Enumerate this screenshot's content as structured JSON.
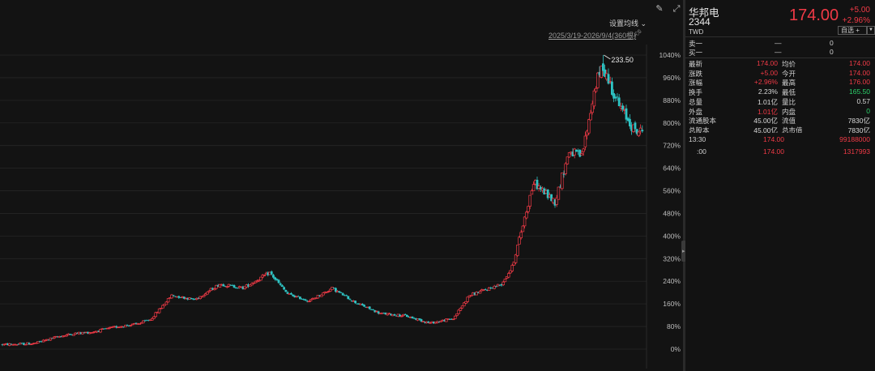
{
  "toolbar": {
    "draw_icon": "pencil-icon",
    "expand_icon": "expand-icon",
    "ma_setting_label": "设置均线",
    "date_range": "2025/3/19-2026/9/4(360根)"
  },
  "colors": {
    "up": "#f03a46",
    "down": "#2ec4c4",
    "green": "#2bd26b",
    "grid": "#262626",
    "background": "#131313"
  },
  "chart_data": {
    "type": "candlestick",
    "title": "",
    "xlabel": "",
    "ylabel": "",
    "y_axis_unit": "%",
    "ylim": [
      -8,
      1060
    ],
    "y_ticks": [
      "1040%",
      "960%",
      "880%",
      "800%",
      "720%",
      "640%",
      "560%",
      "480%",
      "400%",
      "320%",
      "240%",
      "160%",
      "80%",
      "0%"
    ],
    "y_tick_values": [
      1040,
      960,
      880,
      800,
      720,
      640,
      560,
      480,
      400,
      320,
      240,
      160,
      80,
      0
    ],
    "candle_count": 360,
    "start_date": "2025/3/19",
    "end_date": "2026/9/4",
    "peak_label": "233.50",
    "peak_value_pct": 1040,
    "generator_anchors_pct": [
      [
        0,
        16
      ],
      [
        10,
        18
      ],
      [
        18,
        20
      ],
      [
        30,
        42
      ],
      [
        40,
        55
      ],
      [
        50,
        60
      ],
      [
        65,
        80
      ],
      [
        75,
        88
      ],
      [
        83,
        104
      ],
      [
        95,
        190
      ],
      [
        108,
        175
      ],
      [
        122,
        230
      ],
      [
        135,
        216
      ],
      [
        150,
        270
      ],
      [
        160,
        195
      ],
      [
        172,
        170
      ],
      [
        185,
        215
      ],
      [
        198,
        165
      ],
      [
        212,
        126
      ],
      [
        226,
        118
      ],
      [
        240,
        92
      ],
      [
        253,
        108
      ],
      [
        262,
        190
      ],
      [
        280,
        230
      ],
      [
        286,
        290
      ],
      [
        298,
        590
      ],
      [
        310,
        520
      ],
      [
        318,
        700
      ],
      [
        325,
        680
      ],
      [
        333,
        940
      ],
      [
        337,
        1000
      ],
      [
        346,
        860
      ],
      [
        355,
        770
      ]
    ]
  },
  "quote": {
    "name": "华邦电",
    "code": "2344",
    "currency": "TWD",
    "last_price": "174.00",
    "change": "+5.00",
    "change_pct": "+2.96%",
    "watch_label": "自选 +",
    "watch_dropdown_icon": "caret-down-icon"
  },
  "order_book": [
    {
      "label": "卖一",
      "price": "—",
      "volume": "0"
    },
    {
      "label": "买一",
      "price": "—",
      "volume": "0"
    }
  ],
  "stats": [
    {
      "l1": "最新",
      "v1": "174.00",
      "c1": "red",
      "l2": "均价",
      "v2": "174.00",
      "c2": "red"
    },
    {
      "l1": "涨跌",
      "v1": "+5.00",
      "c1": "red",
      "l2": "今开",
      "v2": "174.00",
      "c2": "red"
    },
    {
      "l1": "涨幅",
      "v1": "+2.96%",
      "c1": "red",
      "l2": "最高",
      "v2": "176.00",
      "c2": "red"
    },
    {
      "l1": "换手",
      "v1": "2.23%",
      "c1": "white",
      "l2": "最低",
      "v2": "165.50",
      "c2": "green"
    },
    {
      "l1": "总量",
      "v1": "1.01亿",
      "c1": "white",
      "l2": "量比",
      "v2": "0.57",
      "c2": "white"
    },
    {
      "l1": "外盘",
      "v1": "1.01亿",
      "c1": "red",
      "l2": "内盘",
      "v2": "0",
      "c2": "green"
    },
    {
      "l1": "流通股本",
      "v1": "45.00亿",
      "c1": "white",
      "l2": "流值",
      "v2": "7830亿",
      "c2": "white"
    },
    {
      "l1": "总股本",
      "v1": "45.00亿",
      "c1": "white",
      "l2": "总市值",
      "v2": "7830亿",
      "c2": "white"
    }
  ],
  "ticks": [
    {
      "time": "13:30",
      "price": "174.00",
      "volume": "99188000"
    },
    {
      "time": ":00",
      "price": "174.00",
      "volume": "1317993"
    }
  ]
}
